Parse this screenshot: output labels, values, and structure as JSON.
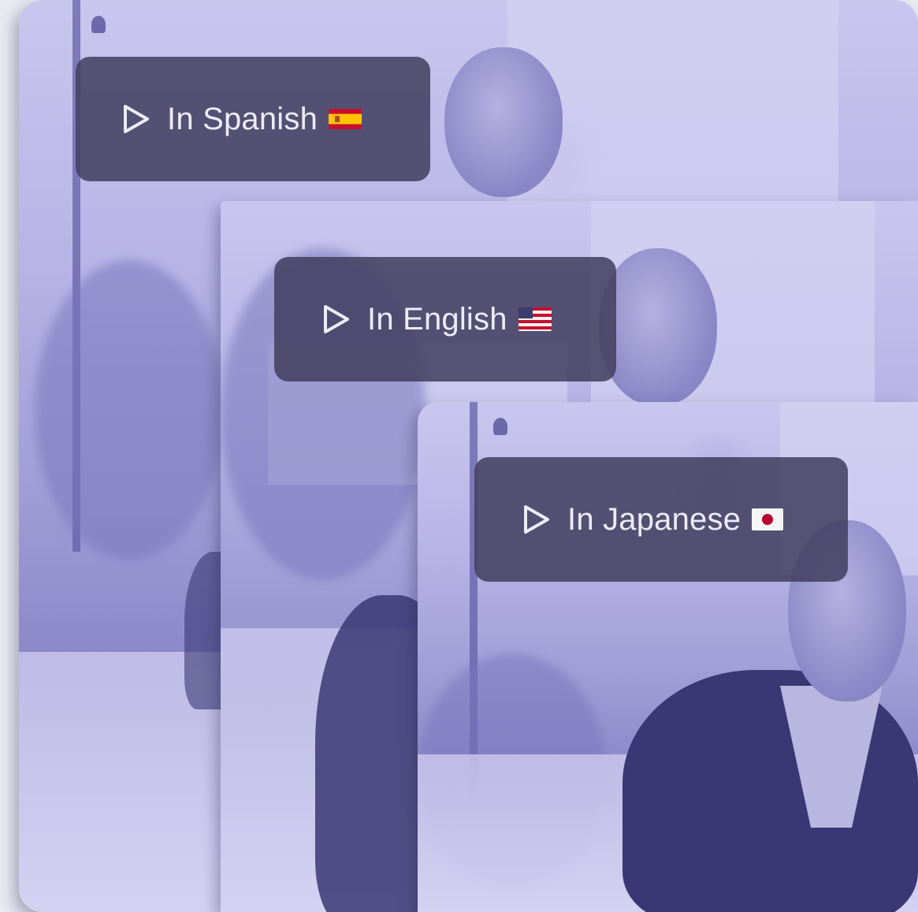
{
  "cards": [
    {
      "id": "spanish",
      "button_label": "In Spanish",
      "language": "Spanish",
      "flag_icon": "spain-flag-icon",
      "play_icon": "play-icon"
    },
    {
      "id": "english",
      "button_label": "In English",
      "language": "English",
      "flag_icon": "us-flag-icon",
      "play_icon": "play-icon"
    },
    {
      "id": "japanese",
      "button_label": "In Japanese",
      "language": "Japanese",
      "flag_icon": "japan-flag-icon",
      "play_icon": "play-icon"
    }
  ],
  "colors": {
    "tint": "#a7a3dc",
    "pill_background": "#444162",
    "pill_text": "#ecebf6"
  }
}
